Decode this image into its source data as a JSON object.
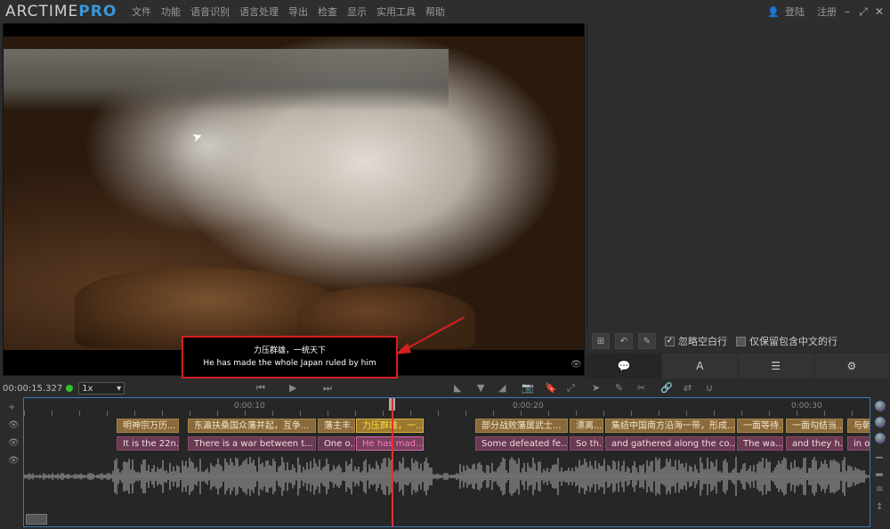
{
  "app": {
    "logo_main": "ARCTIME",
    "logo_pro": "PRO"
  },
  "menu": [
    "文件",
    "功能",
    "语音识别",
    "语言处理",
    "导出",
    "检查",
    "显示",
    "实用工具",
    "帮助"
  ],
  "menu_right": {
    "login": "登陆",
    "register": "注册"
  },
  "subtitle": {
    "zh": "力压群雄，一统天下",
    "en": "He has made the whole Japan ruled by him"
  },
  "right_toolbar": {
    "ignore_blank": "忽略空白行",
    "keep_chinese": "仅保留包含中文的行"
  },
  "right_tabs": [
    "💬",
    "A",
    "☰",
    "⚙"
  ],
  "transport": {
    "timecode": "00:00:15.327",
    "speed": "1x"
  },
  "timeline": {
    "ruler_labels": [
      "0:00:10",
      "0:00:20",
      "0:00:30"
    ],
    "zh_segments": [
      "明神宗万历...",
      "东瀛扶桑国众藩并起，互争...",
      "藩主丰...",
      "力压群雄，一...",
      "部分战败藩属武士...",
      "漂离...",
      "集结中国南方沿海一带，形成...",
      "一面等待...",
      "一面勾结当...",
      "与朝..."
    ],
    "en_segments": [
      "It is the 22n...",
      "There is a war between t...",
      "One o...",
      "He has mad...",
      "Some defeated fe...",
      "So th...",
      "and gathered along the co...",
      "The wa...",
      "and they h...",
      "in o..."
    ]
  }
}
